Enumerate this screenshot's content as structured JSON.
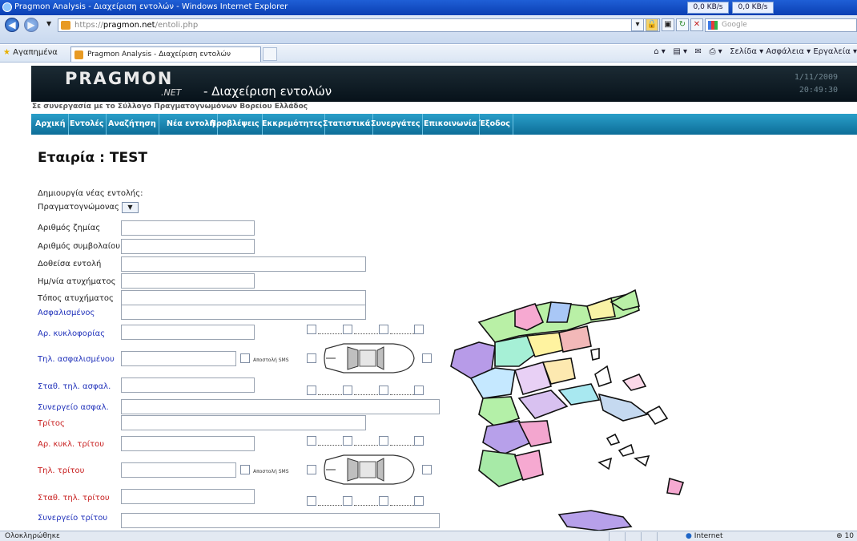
{
  "window": {
    "title": "Pragmon Analysis - Διαχείριση εντολών - Windows Internet Explorer",
    "download_rate": "0,0 KB/s",
    "upload_rate": "0,0 KB/s"
  },
  "browser": {
    "url_prefix": "https://",
    "url_host": "pragmon.net",
    "url_path": "/entoli.php",
    "search_placeholder": "Google",
    "favorites_label": "Αγαπημένα",
    "tab_title": "Pragmon Analysis - Διαχείριση εντολών",
    "command_bar": "Σελίδα ▾   Ασφάλεια ▾   Εργαλεία ▾",
    "status_text": "Ολοκληρώθηκε",
    "zone_text": "Internet",
    "zoom_text": "10"
  },
  "header": {
    "logo_text": "PRAGMON",
    "logo_suffix": ".NET",
    "page_title": "- Διαχείριση εντολών",
    "date": "1/11/2009",
    "time": "20:49:30",
    "collaboration": "Σε συνεργασία με το Σύλλογο Πραγματογνωμόνων Βορείου Ελλάδος"
  },
  "nav": {
    "items": [
      {
        "label": "Αρχική"
      },
      {
        "label": "Εντολές"
      },
      {
        "label": "Αναζήτηση"
      },
      {
        "label": "Νέα εντολή"
      },
      {
        "label": "Προβλέψεις"
      },
      {
        "label": "Εκκρεμότητες"
      },
      {
        "label": "Στατιστικά"
      },
      {
        "label": "Συνεργάτες"
      },
      {
        "label": "Επικοινωνία"
      },
      {
        "label": "Έξοδος"
      }
    ]
  },
  "main": {
    "company_heading": "Εταιρία : TEST",
    "new_task_label": "Δημιουργία νέας εντολής:",
    "appraiser_label": "Πραγματογνώμονας",
    "fields": {
      "claim_no": "Αριθμός ζημίας",
      "contract_no": "Αριθμός συμβολαίου",
      "given_order": "Δοθείσα εντολή",
      "accident_date": "Ημ/νία ατυχήματος",
      "accident_place": "Τόπος ατυχήματος",
      "insured": "Ασφαλισμένος",
      "plate": "Αρ. κυκλοφορίας",
      "insured_phone": "Τηλ. ασφαλισμένου",
      "insured_landline": "Σταθ. τηλ. ασφαλ.",
      "insured_garage": "Συνεργείο ασφαλ.",
      "third_party": "Τρίτος",
      "third_plate": "Αρ. κυκλ. τρίτου",
      "third_phone": "Τηλ. τρίτου",
      "third_landline": "Σταθ. τηλ. τρίτου",
      "third_garage": "Συνεργείο τρίτου"
    },
    "sms_label": "Αποστολή SMS"
  }
}
